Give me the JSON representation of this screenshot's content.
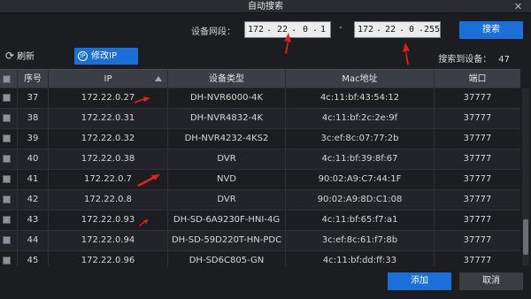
{
  "window": {
    "title": "自动搜索",
    "close_glyph": "✕"
  },
  "range": {
    "label": "设备网段：",
    "start": [
      "172",
      "22",
      "0",
      "1"
    ],
    "end": [
      "172",
      "22",
      "0",
      "255"
    ],
    "dash": "-",
    "search_label": "搜索"
  },
  "toolbar": {
    "refresh_label": "刷新",
    "refresh_icon": "refresh-icon",
    "modify_ip_label": "修改IP",
    "found_label": "搜索到设备：",
    "found_count": "47"
  },
  "table": {
    "columns": [
      "序号",
      "IP",
      "设备类型",
      "Mac地址",
      "端口"
    ],
    "rows": [
      {
        "no": "37",
        "ip": "172.22.0.27",
        "type": "DH-NVR6000-4K",
        "mac": "4c:11:bf:43:54:12",
        "port": "37777"
      },
      {
        "no": "38",
        "ip": "172.22.0.31",
        "type": "DH-NVR4832-4K",
        "mac": "4c:11:bf:2c:2e:9f",
        "port": "37777"
      },
      {
        "no": "39",
        "ip": "172.22.0.32",
        "type": "DH-NVR4232-4KS2",
        "mac": "3c:ef:8c:07:77:2b",
        "port": "37777"
      },
      {
        "no": "40",
        "ip": "172.22.0.38",
        "type": "DVR",
        "mac": "4c:11:bf:39:8f:67",
        "port": "37777"
      },
      {
        "no": "41",
        "ip": "172.22.0.7",
        "type": "NVD",
        "mac": "90:02:A9:C7:44:1F",
        "port": "37777"
      },
      {
        "no": "42",
        "ip": "172.22.0.8",
        "type": "DVR",
        "mac": "90:02:A9:8D:C1:08",
        "port": "37777"
      },
      {
        "no": "43",
        "ip": "172.22.0.93",
        "type": "DH-SD-6A9230F-HNI-4G",
        "mac": "4c:11:bf:65:f7:a1",
        "port": "37777"
      },
      {
        "no": "44",
        "ip": "172.22.0.94",
        "type": "DH-SD-59D220T-HN-PDC",
        "mac": "3c:ef:8c:61:f7:8b",
        "port": "37777"
      },
      {
        "no": "45",
        "ip": "172.22.0.96",
        "type": "DH-SD6C805-GN",
        "mac": "4c:11:bf:dd:ff:33",
        "port": "37777"
      }
    ]
  },
  "footer": {
    "add_label": "添加",
    "cancel_label": "取消"
  },
  "colors": {
    "accent": "#1a6fd8",
    "annotation": "#e02020"
  }
}
